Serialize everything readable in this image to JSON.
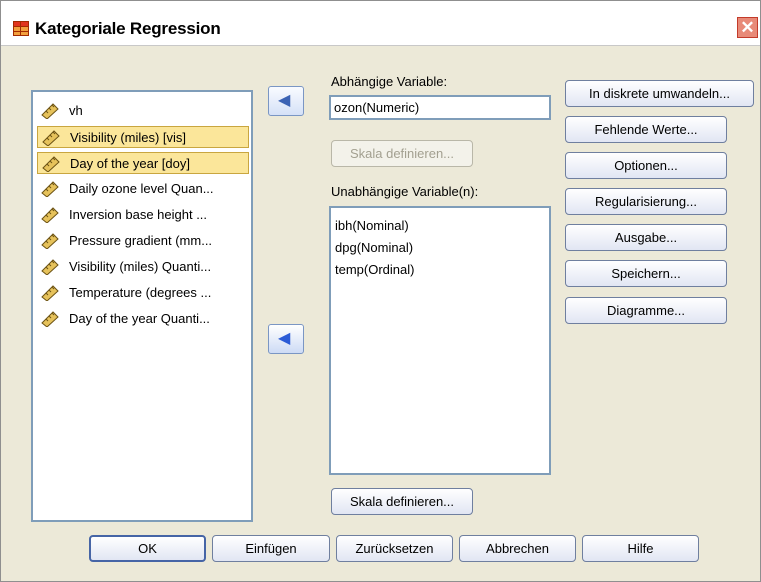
{
  "window": {
    "title": "Kategoriale Regression",
    "close_glyph": "✕",
    "icon": "table-icon"
  },
  "source_variables": [
    {
      "label": "vh",
      "selected": false,
      "icon": "scale-ruler-icon"
    },
    {
      "label": "Visibility (miles) [vis]",
      "selected": true,
      "icon": "scale-ruler-icon"
    },
    {
      "label": "Day of the year [doy]",
      "selected": true,
      "icon": "scale-ruler-icon"
    },
    {
      "label": "Daily ozone level Quan...",
      "selected": false,
      "icon": "scale-ruler-icon"
    },
    {
      "label": "Inversion base height ...",
      "selected": false,
      "icon": "scale-ruler-icon"
    },
    {
      "label": "Pressure gradient (mm...",
      "selected": false,
      "icon": "scale-ruler-icon"
    },
    {
      "label": "Visibility (miles) Quanti...",
      "selected": false,
      "icon": "scale-ruler-icon"
    },
    {
      "label": "Temperature (degrees ...",
      "selected": false,
      "icon": "scale-ruler-icon"
    },
    {
      "label": "Day of the year Quanti...",
      "selected": false,
      "icon": "scale-ruler-icon"
    }
  ],
  "dependent": {
    "label": "Abhängige Variable:",
    "value": "ozon(Numeric)",
    "define_scale_label": "Skala definieren..."
  },
  "independent": {
    "label": "Unabhängige Variable(n):",
    "items": [
      "ibh(Nominal)",
      "dpg(Nominal)",
      "temp(Ordinal)"
    ],
    "define_scale_label": "Skala definieren..."
  },
  "side_buttons": [
    "In diskrete umwandeln...",
    "Fehlende Werte...",
    "Optionen...",
    "Regularisierung...",
    "Ausgabe...",
    "Speichern...",
    "Diagramme..."
  ],
  "bottom_buttons": {
    "ok": "OK",
    "paste": "Einfügen",
    "reset": "Zurücksetzen",
    "cancel": "Abbrechen",
    "help": "Hilfe"
  },
  "colors": {
    "dialog_bg": "#ece9d8",
    "selection": "#fbe69a",
    "list_border": "#7f9db9",
    "arrow": "#3b63b4"
  }
}
